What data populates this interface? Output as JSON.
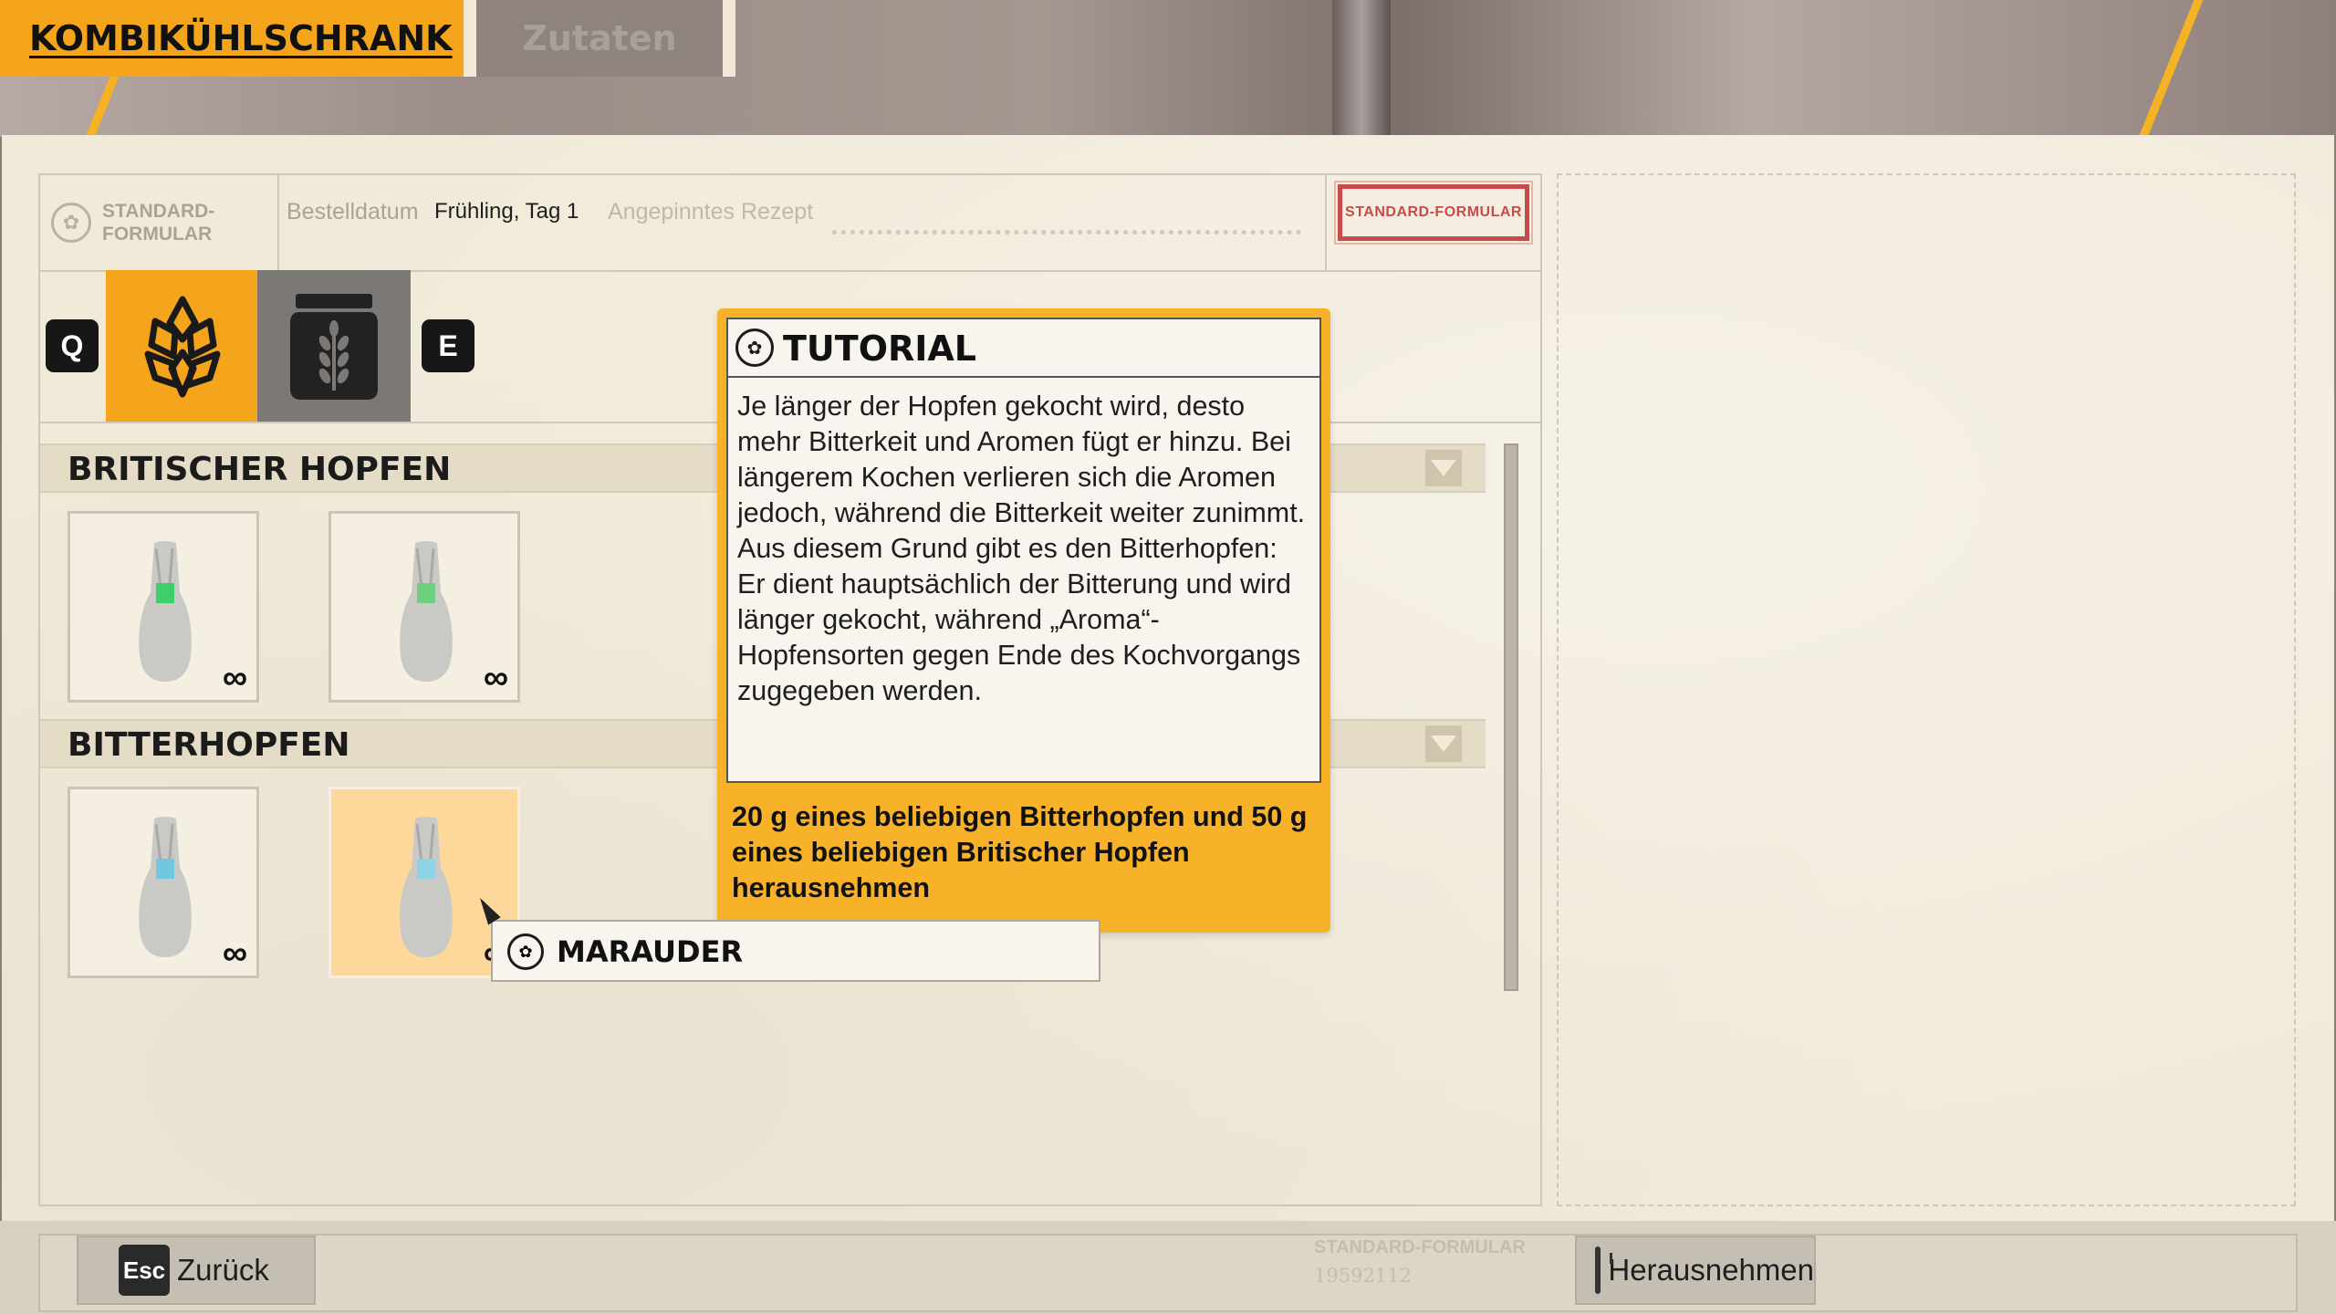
{
  "tabs": [
    {
      "label": "KOMBIKÜHLSCHRANK",
      "active": true
    },
    {
      "label": "Zutaten",
      "active": false
    }
  ],
  "form": {
    "logo_line1": "STANDARD-",
    "logo_line2": "FORMULAR",
    "order_date_label": "Bestelldatum",
    "order_date_value": "Frühling, Tag 1",
    "pinned_recipe_label": "Angepinntes Rezept",
    "stamp": "STANDARD-FORMULAR"
  },
  "category_selector": {
    "prev_key": "Q",
    "next_key": "E",
    "categories": [
      {
        "icon": "hops-icon",
        "active": true
      },
      {
        "icon": "grain-jar-icon",
        "active": false
      }
    ]
  },
  "sections": [
    {
      "title": "BRITISCHER HOPFEN",
      "items": [
        {
          "count": "∞"
        },
        {
          "count": "∞"
        }
      ]
    },
    {
      "title": "BITTERHOPFEN",
      "items": [
        {
          "count": "∞"
        },
        {
          "count": "∞",
          "selected": true
        }
      ]
    }
  ],
  "tutorial": {
    "title": "TUTORIAL",
    "body": "Je länger der Hopfen gekocht wird, desto mehr Bitterkeit und Aromen fügt er hinzu. Bei längerem Kochen verlieren sich die Aromen jedoch, während die Bitterkeit weiter zunimmt. Aus diesem Grund gibt es den Bitterhopfen: Er dient hauptsächlich der Bitterung und wird länger gekocht, während „Aroma“-Hopfensorten gegen Ende des Kochvorgangs zugegeben werden.",
    "task": "20 g eines beliebigen Bitterhopfen und 50 g eines beliebigen Britischer Hopfen herausnehmen"
  },
  "tooltip": {
    "label": "MARAUDER"
  },
  "bottom_bar": {
    "back_key": "Esc",
    "back_label": "Zurück",
    "form_label": "STANDARD-FORMULAR",
    "form_number": "19592112",
    "take_label": "Herausnehmen"
  },
  "colors": {
    "accent": "#f5a51c",
    "paper": "#f1ead9",
    "stamp_red": "#c94a4a",
    "tutorial_orange": "#f7b22a",
    "selected_item": "#fdd89a"
  }
}
